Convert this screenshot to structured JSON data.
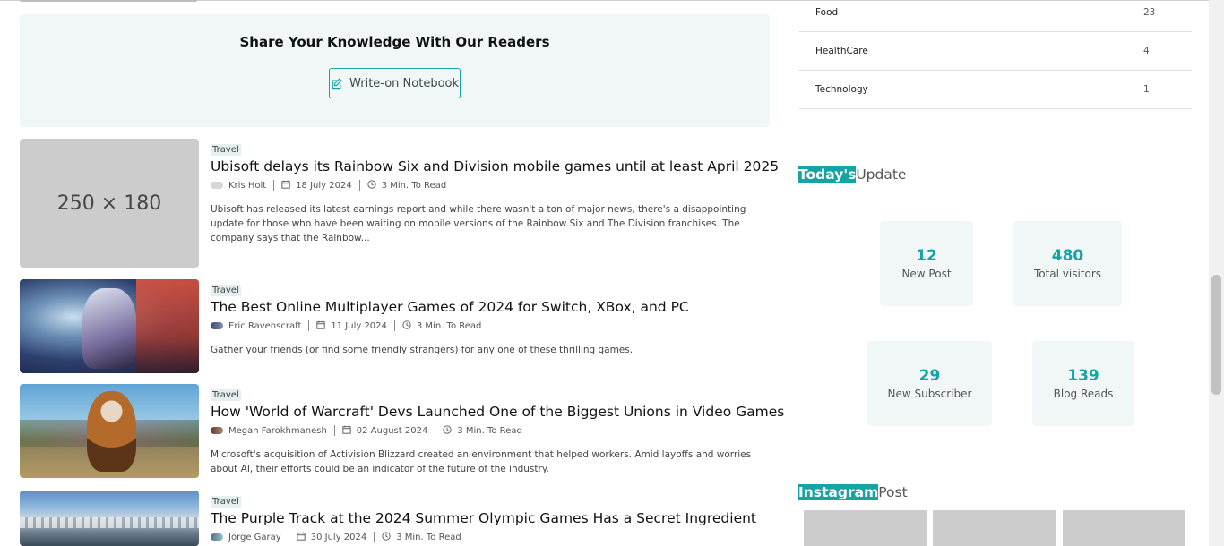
{
  "share": {
    "title": "Share Your Knowledge With Our Readers",
    "button_label": "Write-on Notebook"
  },
  "articles": [
    {
      "category": "Travel",
      "title": "Ubisoft delays its Rainbow Six and Division mobile games until at least April 2025",
      "author": "Kris Holt",
      "date": "18 July 2024",
      "read_time": "3 Min. To Read",
      "excerpt": "Ubisoft has released its latest earnings report and while there wasn't a ton of major news, there's a disappointing update for those who have been waiting on mobile versions of the Rainbow Six and The Division franchises. The company says that the Rainbow...",
      "image_text": "250 × 180"
    },
    {
      "category": "Travel",
      "title": "The Best Online Multiplayer Games of 2024 for Switch, XBox, and PC",
      "author": "Eric Ravenscraft",
      "date": "11 July 2024",
      "read_time": "3 Min. To Read",
      "excerpt": "Gather your friends (or find some friendly strangers) for any one of these thrilling games."
    },
    {
      "category": "Travel",
      "title": "How 'World of Warcraft' Devs Launched One of the Biggest Unions in Video Games",
      "author": "Megan Farokhmanesh",
      "date": "02 August 2024",
      "read_time": "3 Min. To Read",
      "excerpt": "Microsoft's acquisition of Activision Blizzard created an environment that helped workers. Amid layoffs and worries about AI, their efforts could be an indicator of the future of the industry."
    },
    {
      "category": "Travel",
      "title": "The Purple Track at the 2024 Summer Olympic Games Has a Secret Ingredient",
      "author": "Jorge Garay",
      "date": "30 July 2024",
      "read_time": "3 Min. To Read"
    }
  ],
  "sidebar": {
    "categories": [
      {
        "name": "Food",
        "count": "23"
      },
      {
        "name": "HealthCare",
        "count": "4"
      },
      {
        "name": "Technology",
        "count": "1"
      }
    ],
    "today": {
      "highlight": "Today's",
      "rest": "Update",
      "stats": [
        {
          "value": "12",
          "label": "New Post"
        },
        {
          "value": "480",
          "label": "Total visitors"
        },
        {
          "value": "29",
          "label": "New Subscriber"
        },
        {
          "value": "139",
          "label": "Blog Reads"
        }
      ]
    },
    "instagram": {
      "highlight": "Instagram",
      "rest": "Post"
    }
  },
  "colors": {
    "accent": "#16a3a3",
    "card_bg": "#f1f7f7",
    "placeholder": "#cccccc"
  },
  "icons": [
    "edit-icon",
    "calendar-icon",
    "clock-icon"
  ]
}
